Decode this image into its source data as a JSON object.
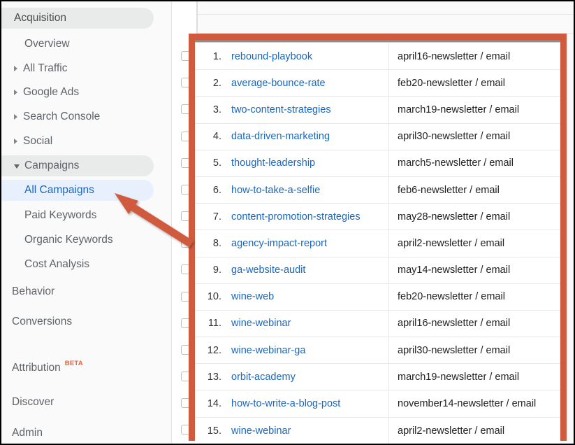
{
  "sidebar": {
    "section_title": "Acquisition",
    "items": [
      {
        "label": "Overview",
        "level": "sub",
        "caret": "none",
        "pill": "none",
        "state": "normal"
      },
      {
        "label": "All Traffic",
        "level": "top",
        "caret": "right",
        "pill": "none",
        "state": "normal"
      },
      {
        "label": "Google Ads",
        "level": "top",
        "caret": "right",
        "pill": "none",
        "state": "normal"
      },
      {
        "label": "Search Console",
        "level": "top",
        "caret": "right",
        "pill": "none",
        "state": "normal"
      },
      {
        "label": "Social",
        "level": "top",
        "caret": "right",
        "pill": "none",
        "state": "normal"
      },
      {
        "label": "Campaigns",
        "level": "top",
        "caret": "down",
        "pill": "grey",
        "state": "expanded"
      },
      {
        "label": "All Campaigns",
        "level": "sub",
        "caret": "none",
        "pill": "blue",
        "state": "selected"
      },
      {
        "label": "Paid Keywords",
        "level": "sub",
        "caret": "none",
        "pill": "none",
        "state": "normal"
      },
      {
        "label": "Organic Keywords",
        "level": "sub",
        "caret": "none",
        "pill": "none",
        "state": "normal"
      },
      {
        "label": "Cost Analysis",
        "level": "sub",
        "caret": "none",
        "pill": "none",
        "state": "normal"
      },
      {
        "label": "Behavior",
        "level": "top",
        "caret": "none",
        "pill": "none",
        "state": "normal"
      },
      {
        "label": "Conversions",
        "level": "top",
        "caret": "none",
        "pill": "none",
        "state": "normal"
      },
      {
        "label": "Attribution",
        "level": "top",
        "caret": "none",
        "pill": "none",
        "state": "normal",
        "badge": "BETA"
      },
      {
        "label": "Discover",
        "level": "top",
        "caret": "none",
        "pill": "none",
        "state": "normal"
      },
      {
        "label": "Admin",
        "level": "top",
        "caret": "none",
        "pill": "none",
        "state": "normal"
      }
    ]
  },
  "table": {
    "rows": [
      {
        "index": "1.",
        "campaign": "rebound-playbook",
        "source_medium": "april16-newsletter / email"
      },
      {
        "index": "2.",
        "campaign": "average-bounce-rate",
        "source_medium": "feb20-newsletter / email"
      },
      {
        "index": "3.",
        "campaign": "two-content-strategies",
        "source_medium": "march19-newsletter / email"
      },
      {
        "index": "4.",
        "campaign": "data-driven-marketing",
        "source_medium": "april30-newsletter / email"
      },
      {
        "index": "5.",
        "campaign": "thought-leadership",
        "source_medium": "march5-newsletter / email"
      },
      {
        "index": "6.",
        "campaign": "how-to-take-a-selfie",
        "source_medium": "feb6-newsletter / email"
      },
      {
        "index": "7.",
        "campaign": "content-promotion-strategies",
        "source_medium": "may28-newsletter / email"
      },
      {
        "index": "8.",
        "campaign": "agency-impact-report",
        "source_medium": "april2-newsletter / email"
      },
      {
        "index": "9.",
        "campaign": "ga-website-audit",
        "source_medium": "may14-newsletter / email"
      },
      {
        "index": "10.",
        "campaign": "wine-web",
        "source_medium": "feb20-newsletter / email"
      },
      {
        "index": "11.",
        "campaign": "wine-webinar",
        "source_medium": "april16-newsletter / email"
      },
      {
        "index": "12.",
        "campaign": "wine-webinar-ga",
        "source_medium": "april30-newsletter / email"
      },
      {
        "index": "13.",
        "campaign": "orbit-academy",
        "source_medium": "march19-newsletter / email"
      },
      {
        "index": "14.",
        "campaign": "how-to-write-a-blog-post",
        "source_medium": "november14-newsletter / email"
      },
      {
        "index": "15.",
        "campaign": "wine-webinar",
        "source_medium": "april2-newsletter / email"
      }
    ]
  },
  "annotations": {
    "highlight_box_color": "#d05a3e",
    "arrow_color": "#d05a3e",
    "arrow_points_to": "All Campaigns"
  },
  "colors": {
    "link": "#1967c0",
    "selected_pill": "#e8f0fe",
    "expanded_pill": "#e9eaea",
    "beta_badge": "#e8613c"
  }
}
